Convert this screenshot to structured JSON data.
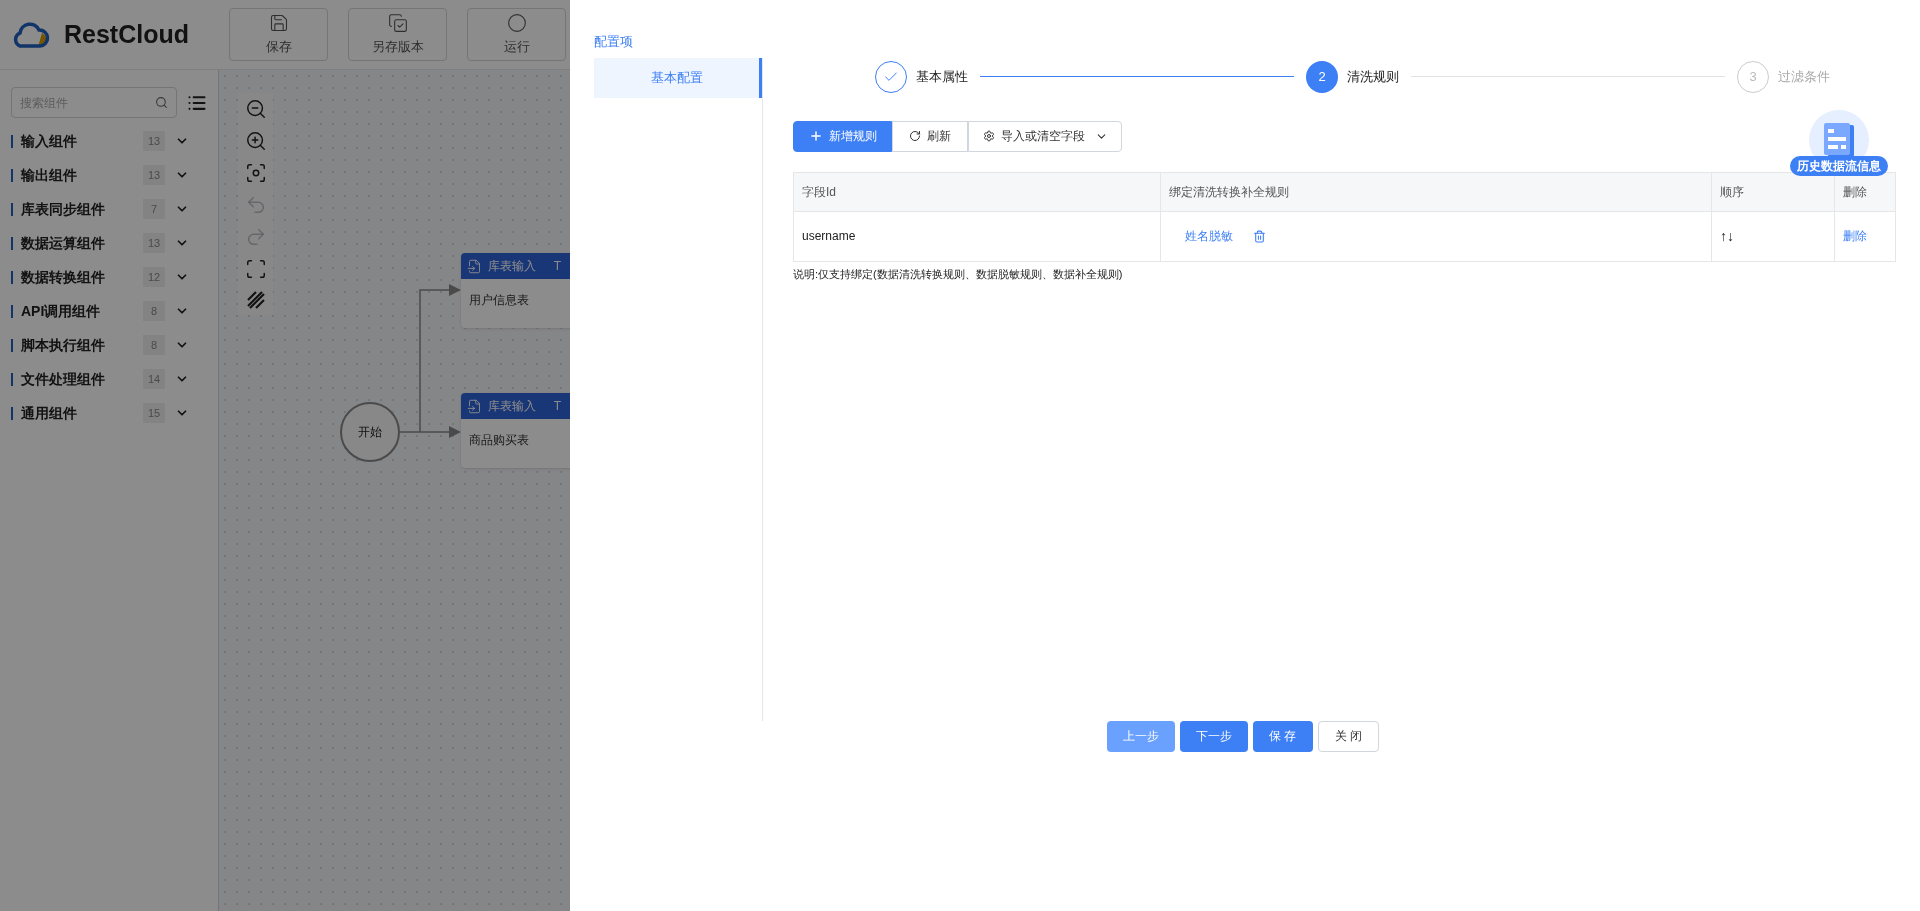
{
  "app": {
    "logo": "RestCloud",
    "toolbar": [
      {
        "label": "保存",
        "kind": "save"
      },
      {
        "label": "另存版本",
        "kind": "version"
      },
      {
        "label": "运行",
        "kind": "run"
      }
    ]
  },
  "sidebar": {
    "search_placeholder": "搜索组件",
    "groups": [
      {
        "name": "输入组件",
        "count": "13"
      },
      {
        "name": "输出组件",
        "count": "13"
      },
      {
        "name": "库表同步组件",
        "count": "7"
      },
      {
        "name": "数据运算组件",
        "count": "13"
      },
      {
        "name": "数据转换组件",
        "count": "12"
      },
      {
        "name": "API调用组件",
        "count": "8"
      },
      {
        "name": "脚本执行组件",
        "count": "8"
      },
      {
        "name": "文件处理组件",
        "count": "14"
      },
      {
        "name": "通用组件",
        "count": "15"
      }
    ]
  },
  "canvas": {
    "tools": [
      {
        "kind": "zoom_out",
        "disabled": false
      },
      {
        "kind": "zoom_in",
        "disabled": false
      },
      {
        "kind": "fit",
        "disabled": false
      },
      {
        "kind": "undo",
        "disabled": true
      },
      {
        "kind": "redo",
        "disabled": true
      },
      {
        "kind": "frame",
        "disabled": false
      },
      {
        "kind": "grid",
        "disabled": false
      }
    ],
    "start": "开始",
    "nodes": [
      {
        "type": "库表输入",
        "tag": "T",
        "name": "用户信息表"
      },
      {
        "type": "库表输入",
        "tag": "T",
        "name": "商品购买表"
      }
    ]
  },
  "drawer": {
    "nav_title": "配置项",
    "nav_items": [
      {
        "label": "基本配置",
        "selected": true
      }
    ],
    "steps": [
      {
        "label": "基本属性",
        "done": true,
        "active": false
      },
      {
        "number": "2",
        "label": "清洗规则",
        "done": false,
        "active": true
      },
      {
        "number": "3",
        "label": "过滤条件",
        "done": false,
        "active": false
      }
    ],
    "actions": [
      {
        "label": "新增规则",
        "kind": "add"
      },
      {
        "label": "刷新",
        "kind": "refresh"
      },
      {
        "label": "导入或清空字段",
        "kind": "menu"
      }
    ],
    "table": {
      "columns": [
        "字段Id",
        "绑定清洗转换补全规则",
        "顺序",
        "删除"
      ],
      "rows": [
        {
          "field": "username",
          "rule": "姓名脱敏",
          "order": "↑↓",
          "action": "删除"
        }
      ]
    },
    "note": "说明:仅支持绑定(数据清洗转换规则、数据脱敏规则、数据补全规则)",
    "history_badge": "历史数据流信息",
    "footer": [
      {
        "label": "上一步",
        "kind": "light"
      },
      {
        "label": "下一步",
        "kind": "primary"
      },
      {
        "label": "保 存",
        "kind": "primary"
      },
      {
        "label": "关 闭",
        "kind": "plain"
      }
    ]
  }
}
